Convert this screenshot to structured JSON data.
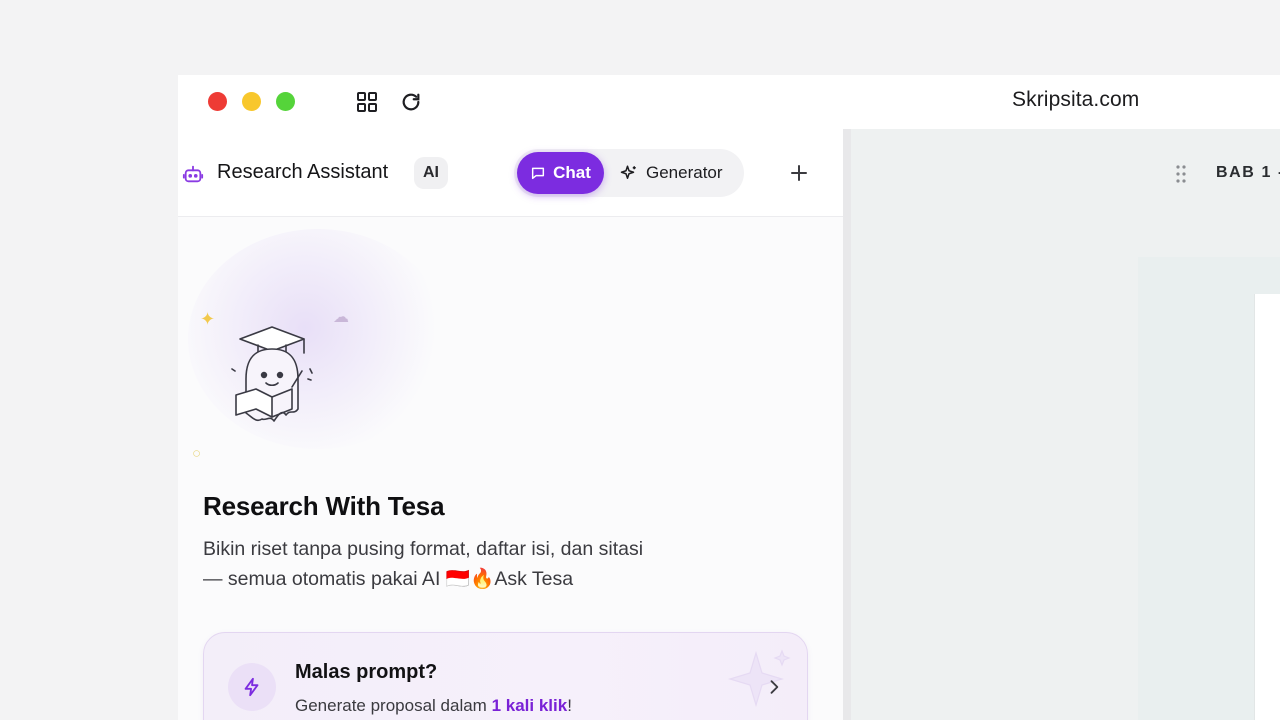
{
  "titlebar": {
    "url": "Skripsita.com",
    "icons": [
      "grid-icon",
      "reload-icon"
    ]
  },
  "panel": {
    "title": "Research Assistant",
    "badge": "AI",
    "tabs": [
      {
        "label": "Chat",
        "active": true
      },
      {
        "label": "Generator",
        "active": false
      }
    ]
  },
  "hero": {
    "heading": "Research With Tesa",
    "line1": "Bikin riset tanpa pusing format, daftar isi, dan sitasi",
    "line2": "— semua otomatis pakai AI 🇮🇩🔥Ask Tesa"
  },
  "card": {
    "title": "Malas prompt?",
    "desc_prefix": "Generate proposal dalam ",
    "desc_highlight": "1 kali klik",
    "desc_suffix": "!"
  },
  "right": {
    "section": "BAB 1 -"
  },
  "colors": {
    "accent": "#7c2ce0",
    "traffic_red": "#ee3b35",
    "traffic_yellow": "#f8c72c",
    "traffic_green": "#55d43a"
  }
}
